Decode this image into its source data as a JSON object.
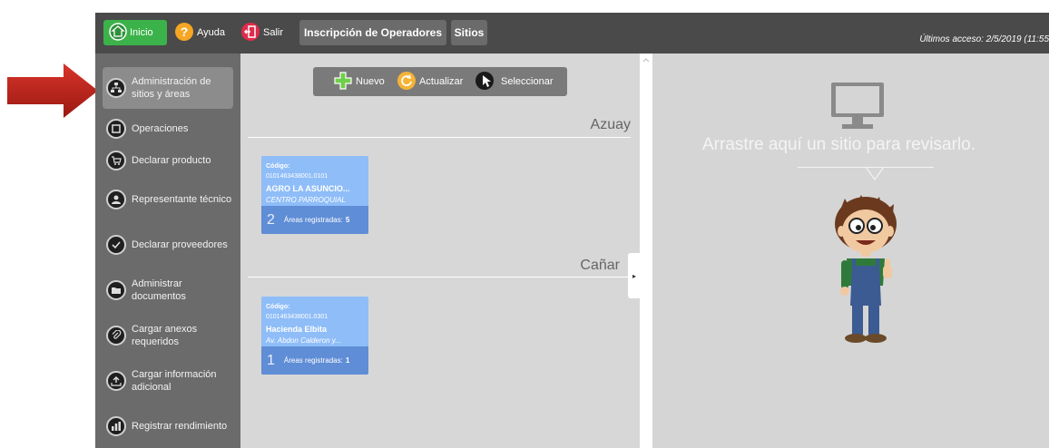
{
  "topbar": {
    "inicio_label": "Inicio",
    "ayuda_label": "Ayuda",
    "salir_label": "Salir",
    "tab_inscripcion": "Inscripción de Operadores",
    "tab_sitios": "Sitios",
    "last_access": "Últimos acceso: 2/5/2019 (11:55"
  },
  "sidebar": {
    "items": [
      {
        "label": "Administración de sitios y áreas",
        "icon": "sitemap-icon"
      },
      {
        "label": "Operaciones",
        "icon": "operations-icon"
      },
      {
        "label": "Declarar producto",
        "icon": "cart-icon"
      },
      {
        "label": "Representante técnico",
        "icon": "user-icon"
      },
      {
        "label": "Declarar proveedores",
        "icon": "check-icon"
      },
      {
        "label": "Administrar documentos",
        "icon": "folder-icon"
      },
      {
        "label": "Cargar anexos requeridos",
        "icon": "paperclip-icon"
      },
      {
        "label": "Cargar información adicional",
        "icon": "upload-icon"
      },
      {
        "label": "Registrar rendimiento",
        "icon": "chart-icon"
      }
    ]
  },
  "toolbar": {
    "nuevo_label": "Nuevo",
    "actualizar_label": "Actualizar",
    "seleccionar_label": "Seleccionar"
  },
  "regions": [
    {
      "name": "Azuay",
      "site": {
        "code_label": "Código:",
        "code": "0101463438001.0101",
        "name": "AGRO LA ASUNCIO...",
        "address": "CENTRO PARROQUIAL",
        "count": "2",
        "areas_label": "Áreas registradas:",
        "areas": "5"
      }
    },
    {
      "name": "Cañar",
      "site": {
        "code_label": "Código:",
        "code": "0101463438001.0301",
        "name": "Hacienda Elbita",
        "address": "Av. Abdon Calderon y...",
        "count": "1",
        "areas_label": "Áreas registradas:",
        "areas": "1"
      }
    }
  ],
  "dropzone": {
    "text": "Arrastre aquí un sitio para revisarlo."
  },
  "colors": {
    "accent_green": "#3bb34a",
    "card_blue": "#8fbdf8",
    "card_footer_blue": "#5f8dd6",
    "arrow_red": "#c0261c"
  }
}
